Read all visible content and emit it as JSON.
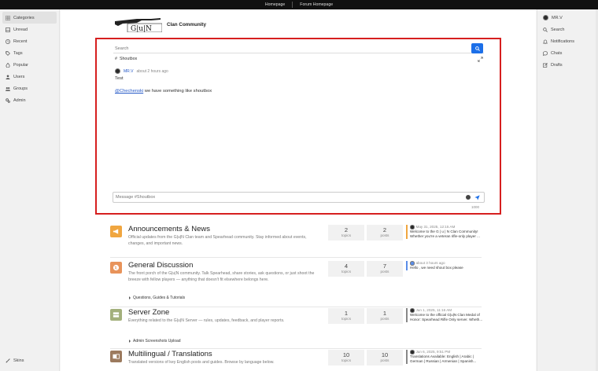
{
  "topbar": {
    "links": [
      "Homepage",
      "Forum Homepage"
    ]
  },
  "left_nav": {
    "items": [
      {
        "label": "Categories",
        "icon": "categories-icon",
        "active": true
      },
      {
        "label": "Unread",
        "icon": "inbox-icon"
      },
      {
        "label": "Recent",
        "icon": "clock-icon"
      },
      {
        "label": "Tags",
        "icon": "tag-icon"
      },
      {
        "label": "Popular",
        "icon": "fire-icon"
      },
      {
        "label": "Users",
        "icon": "user-icon"
      },
      {
        "label": "Groups",
        "icon": "group-icon"
      },
      {
        "label": "Admin",
        "icon": "cogs-icon"
      }
    ],
    "skins_label": "Skins"
  },
  "right_nav": {
    "username": "MR.V",
    "items": [
      {
        "label": "Search",
        "icon": "search-icon"
      },
      {
        "label": "Notifications",
        "icon": "bell-icon"
      },
      {
        "label": "Chats",
        "icon": "chat-icon"
      },
      {
        "label": "Drafts",
        "icon": "edit-icon"
      }
    ]
  },
  "brand": {
    "title": "Clan Community",
    "logo_text": "G|u|N"
  },
  "chat": {
    "search_placeholder": "Search",
    "channel": "Shoutbox",
    "message": {
      "user": "MR.V",
      "time": "about 2 hours ago",
      "line1": "Test",
      "mention": "@Chechenski",
      "line2_rest": " we have something like shoutbox"
    },
    "compose_placeholder": "Message #Shoutbox",
    "char_limit": "1000"
  },
  "categories": [
    {
      "title": "Announcements & News",
      "description": "Official updates from the G|u|N Clan team and Spearhead community. Stay informed about events, changes, and important news.",
      "color": "#f0a640",
      "icon": "megaphone-icon",
      "topics": "2",
      "posts": "2",
      "topics_label": "topics",
      "posts_label": "posts",
      "last_date": "May 31, 2025, 12:15 AM",
      "last_text": "Welcome to the G | u | N Clan Community! Whether you're a veteran rifle-only player ...",
      "last_color": "#f0a640",
      "subs": []
    },
    {
      "title": "General Discussion",
      "description": "The front porch of the G|u|N community. Talk Spearhead, share stories, ask questions, or just shoot the breeze with fellow players — anything that doesn't fit elsewhere belongs here.",
      "color": "#e8935a",
      "icon": "globe-icon",
      "topics": "4",
      "posts": "7",
      "topics_label": "topics",
      "posts_label": "posts",
      "last_date": "about 3 hours ago",
      "last_text": "Hello , we need shout box please",
      "last_color": "#5a8de8",
      "subs": [
        "Questions, Guides & Tutorials"
      ]
    },
    {
      "title": "Server Zone",
      "description": "Everything related to the G|u|N Server — rules, updates, feedback, and player reports.",
      "color": "#a3b07c",
      "icon": "server-icon",
      "topics": "1",
      "posts": "1",
      "topics_label": "topics",
      "posts_label": "posts",
      "last_date": "Jun 1, 2025, 11:16 AM",
      "last_text": "Welcome to the official G|u|N Clan Medal of Honor: Spearhead Rifle Only server. Wheth...",
      "last_color": "#888888",
      "subs": [
        "Admin Screenshots Upload"
      ]
    },
    {
      "title": "Multilingual / Translations",
      "description": "Translated versions of key English posts and guides. Browse by language below.",
      "color": "#9c7a5e",
      "icon": "language-icon",
      "topics": "10",
      "posts": "10",
      "topics_label": "topics",
      "posts_label": "posts",
      "last_date": "Jun 6, 2025, 9:51 PM",
      "last_text": "Translations Available: English | Arabic | German | Russian | Armenian | Spanish...",
      "last_color": "#888888",
      "subs": []
    }
  ]
}
